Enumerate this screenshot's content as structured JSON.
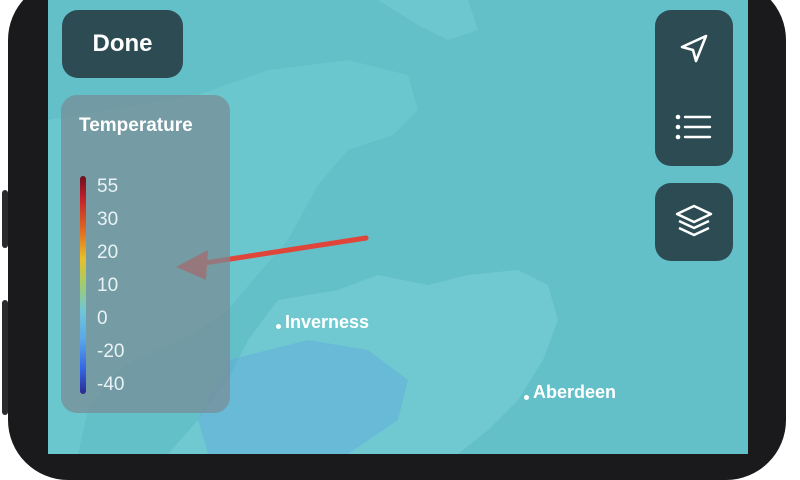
{
  "header": {
    "done_label": "Done"
  },
  "controls": {
    "location_icon": "location-arrow-icon",
    "list_icon": "list-icon",
    "layers_icon": "layers-icon"
  },
  "legend": {
    "title": "Temperature",
    "ticks": [
      "55",
      "30",
      "20",
      "10",
      "0",
      "-20",
      "-40"
    ]
  },
  "map": {
    "cities": [
      {
        "name": "Inverness"
      },
      {
        "name": "Aberdeen"
      }
    ]
  },
  "colors": {
    "control_bg": "#2c4b52",
    "map_water": "#63bfc8",
    "arrow": "#e0453a"
  }
}
